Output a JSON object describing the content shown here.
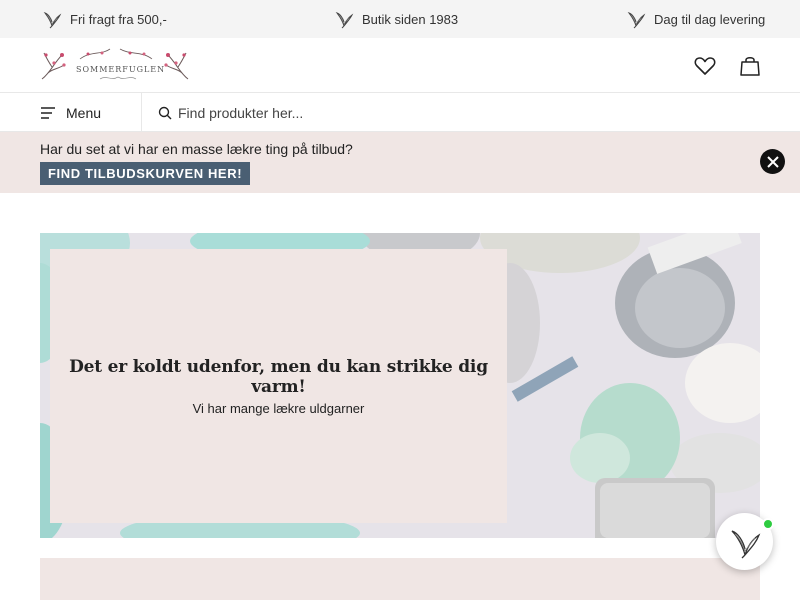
{
  "infobar": {
    "items": [
      {
        "label": "Fri fragt fra 500,-",
        "icon": "butterfly-icon"
      },
      {
        "label": "Butik siden 1983",
        "icon": "butterfly-icon"
      },
      {
        "label": "Dag til dag levering",
        "icon": "butterfly-icon"
      }
    ]
  },
  "header": {
    "logo_text": "SOMMERFUGLEN",
    "icons": [
      "heart-icon",
      "shopping-bag-icon"
    ]
  },
  "nav": {
    "menu_label": "Menu",
    "search_placeholder": "Find produkter her..."
  },
  "promo": {
    "text": "Har du set at vi har en masse lækre ting på tilbud?",
    "cta_label": "FIND TILBUDSKURVEN HER!"
  },
  "hero": {
    "title": "Det er koldt udenfor, men du kan strikke dig varm!",
    "subtitle": "Vi har mange lækre uldgarner"
  },
  "colors": {
    "infobar_bg": "#f4f4f4",
    "promo_bg": "#f0e6e4",
    "cta_bg": "#4a5f73",
    "online_dot": "#2ecc40"
  }
}
